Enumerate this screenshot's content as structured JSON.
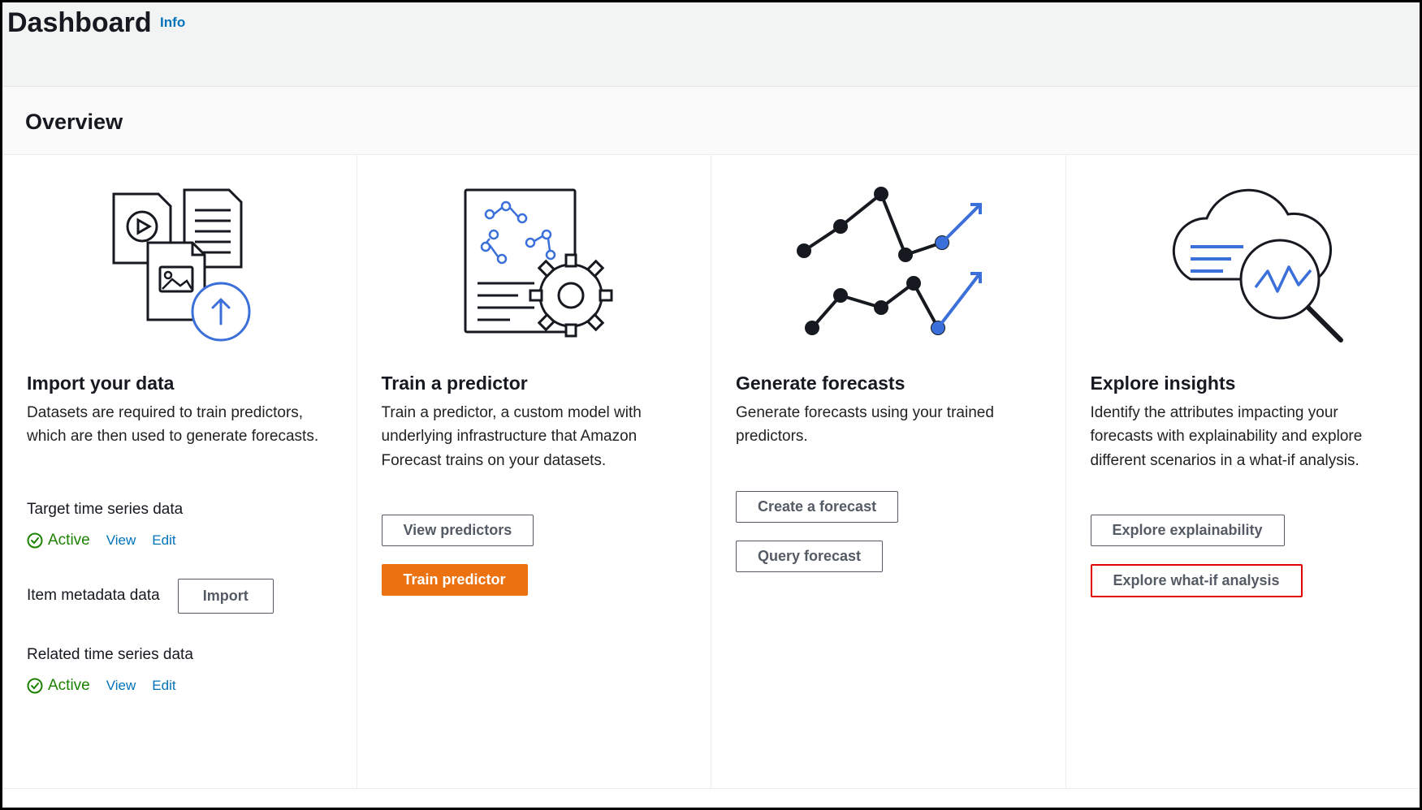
{
  "header": {
    "title": "Dashboard",
    "info_label": "Info"
  },
  "overview_title": "Overview",
  "cards": {
    "import": {
      "heading": "Import your data",
      "desc": "Datasets are required to train predictors, which are then used to generate forecasts.",
      "target_label": "Target time series data",
      "status_active": "Active",
      "view_link": "View",
      "edit_link": "Edit",
      "item_meta_label": "Item metadata data",
      "import_btn": "Import",
      "related_label": "Related time series data"
    },
    "train": {
      "heading": "Train a predictor",
      "desc": "Train a predictor, a custom model with underlying infrastructure that Amazon Forecast trains on your datasets.",
      "view_btn": "View predictors",
      "train_btn": "Train predictor"
    },
    "generate": {
      "heading": "Generate forecasts",
      "desc": "Generate forecasts using your trained predictors.",
      "create_btn": "Create a forecast",
      "query_btn": "Query forecast"
    },
    "insights": {
      "heading": "Explore insights",
      "desc": "Identify the attributes impacting your forecasts with explainability and explore different scenarios in a what-if analysis.",
      "explain_btn": "Explore explainability",
      "whatif_btn": "Explore what-if analysis"
    }
  }
}
